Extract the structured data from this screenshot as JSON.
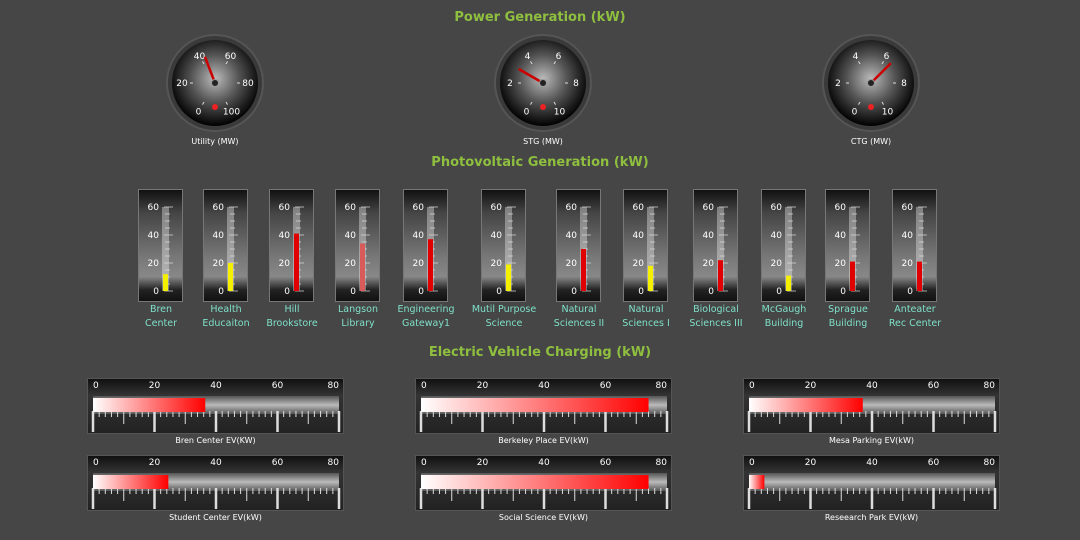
{
  "sections": {
    "power": "Power Generation (kW)",
    "pv": "Photovoltaic Generation (kW)",
    "ev": "Electric Vehicle Charging (kW)"
  },
  "colors": {
    "title": "#8fbf3f",
    "label": "#7fe0c8",
    "bar_red": "#ff0000",
    "bar_yellow": "#ffff00"
  },
  "gauges": [
    {
      "label": "Utility (MW)",
      "ticks": [
        "0",
        "20",
        "40",
        "60",
        "80",
        "100"
      ],
      "min": 0,
      "max": 100,
      "value": 43
    },
    {
      "label": "STG (MW)",
      "ticks": [
        "0",
        "2",
        "4",
        "6",
        "8",
        "10"
      ],
      "min": 0,
      "max": 10,
      "value": 3
    },
    {
      "label": "CTG (MW)",
      "ticks": [
        "0",
        "2",
        "4",
        "6",
        "8",
        "10"
      ],
      "min": 0,
      "max": 10,
      "value": 6.5
    }
  ],
  "thermometers": {
    "ticks": [
      "0",
      "20",
      "40",
      "60"
    ],
    "max": 60,
    "items": [
      {
        "line1": "Bren",
        "line2": "Center",
        "value": 12,
        "color": "yellow"
      },
      {
        "line1": "Health",
        "line2": "Educaiton",
        "value": 20,
        "color": "yellow"
      },
      {
        "line1": "Hill",
        "line2": "Brookstore",
        "value": 41,
        "color": "red"
      },
      {
        "line1": "Langson",
        "line2": "Library",
        "value": 34,
        "color": "faded-red"
      },
      {
        "line1": "Engineering",
        "line2": "Gateway1",
        "value": 37,
        "color": "red"
      },
      {
        "line1": "Mutil Purpose",
        "line2": "Science",
        "value": 19,
        "color": "yellow"
      },
      {
        "line1": "Natural",
        "line2": "Sciences II",
        "value": 30,
        "color": "red"
      },
      {
        "line1": "Natural",
        "line2": "Sciences I",
        "value": 18,
        "color": "yellow"
      },
      {
        "line1": "Biological",
        "line2": "Sciences III",
        "value": 22,
        "color": "red"
      },
      {
        "line1": "McGaugh",
        "line2": "Building",
        "value": 11,
        "color": "yellow"
      },
      {
        "line1": "Sprague",
        "line2": "Building",
        "value": 21,
        "color": "red"
      },
      {
        "line1": "Anteater",
        "line2": "Rec Center",
        "value": 21,
        "color": "red"
      }
    ]
  },
  "ev": {
    "ticks": [
      "0",
      "20",
      "40",
      "60",
      "80"
    ],
    "max": 80,
    "items": [
      {
        "label": "Bren Center EV(KW)",
        "value": 36.5
      },
      {
        "label": "Berkeley Place EV(kW)",
        "value": 74
      },
      {
        "label": "Mesa Parking EV(kW)",
        "value": 37
      },
      {
        "label": "Student Center EV(kW)",
        "value": 24.5
      },
      {
        "label": "Social Science EV(kW)",
        "value": 74
      },
      {
        "label": "Reseearch Park EV(kW)",
        "value": 5
      }
    ]
  }
}
